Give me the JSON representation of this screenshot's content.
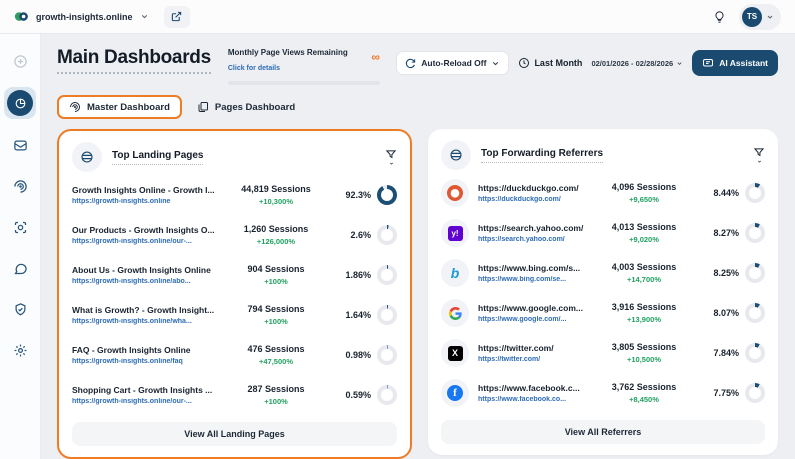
{
  "topbar": {
    "site": "growth-insights.online",
    "avatar_initials": "TS"
  },
  "header": {
    "title": "Main Dashboards",
    "monthly_label": "Monthly Page Views Remaining",
    "monthly_link": "Click for details",
    "infinity": "∞",
    "auto_reload_label": "Auto-Reload Off",
    "period_label": "Last Month",
    "date_range": "02/01/2026 - 02/28/2026",
    "ai_assistant_label": "AI Assistant"
  },
  "tabs": [
    {
      "label": "Master Dashboard",
      "active": true
    },
    {
      "label": "Pages Dashboard",
      "active": false
    }
  ],
  "colors": {
    "accent_orange": "#ee7c25",
    "navy": "#1b4a70",
    "green": "#21a061",
    "link_blue": "#2d6cb4"
  },
  "cards": [
    {
      "title": "Top Landing Pages",
      "footer": "View All Landing Pages",
      "rows": [
        {
          "title": "Growth Insights Online - Growth I...",
          "url": "https://growth-insights.online",
          "sessions": "44,819 Sessions",
          "change": "+10,300%",
          "pct": "92.3%",
          "pct_num": 92.3
        },
        {
          "title": "Our Products - Growth Insights O...",
          "url": "https://growth-insights.online/our-...",
          "sessions": "1,260 Sessions",
          "change": "+126,000%",
          "pct": "2.6%",
          "pct_num": 2.6
        },
        {
          "title": "About Us - Growth Insights Online",
          "url": "https://growth-insights.online/abo...",
          "sessions": "904 Sessions",
          "change": "+100%",
          "pct": "1.86%",
          "pct_num": 1.86
        },
        {
          "title": "What is Growth? - Growth Insight...",
          "url": "https://growth-insights.online/wha...",
          "sessions": "794 Sessions",
          "change": "+100%",
          "pct": "1.64%",
          "pct_num": 1.64
        },
        {
          "title": "FAQ - Growth Insights Online",
          "url": "https://growth-insights.online/faq",
          "sessions": "476 Sessions",
          "change": "+47,500%",
          "pct": "0.98%",
          "pct_num": 0.98
        },
        {
          "title": "Shopping Cart - Growth Insights ...",
          "url": "https://growth-insights.online/our-...",
          "sessions": "287 Sessions",
          "change": "+100%",
          "pct": "0.59%",
          "pct_num": 0.59
        }
      ]
    },
    {
      "title": "Top Forwarding Referrers",
      "footer": "View All Referrers",
      "rows": [
        {
          "title": "https://duckduckgo.com/",
          "url": "https://duckduckgo.com/",
          "brand": "duckduckgo",
          "glyph": "",
          "sessions": "4,096 Sessions",
          "change": "+9,650%",
          "pct": "8.44%",
          "pct_num": 8.44
        },
        {
          "title": "https://search.yahoo.com/",
          "url": "https://search.yahoo.com/",
          "brand": "yahoo",
          "glyph": "y!",
          "sessions": "4,013 Sessions",
          "change": "+9,020%",
          "pct": "8.27%",
          "pct_num": 8.27
        },
        {
          "title": "https://www.bing.com/s...",
          "url": "https://www.bing.com/se...",
          "brand": "bing",
          "glyph": "b",
          "sessions": "4,003 Sessions",
          "change": "+14,700%",
          "pct": "8.25%",
          "pct_num": 8.25
        },
        {
          "title": "https://www.google.com...",
          "url": "https://www.google.com/...",
          "brand": "google",
          "glyph": "G",
          "sessions": "3,916 Sessions",
          "change": "+13,900%",
          "pct": "8.07%",
          "pct_num": 8.07
        },
        {
          "title": "https://twitter.com/",
          "url": "https://twitter.com/",
          "brand": "twitter",
          "glyph": "X",
          "sessions": "3,805 Sessions",
          "change": "+10,500%",
          "pct": "7.84%",
          "pct_num": 7.84
        },
        {
          "title": "https://www.facebook.c...",
          "url": "https://www.facebook.co...",
          "brand": "facebook",
          "glyph": "f",
          "sessions": "3,762 Sessions",
          "change": "+8,450%",
          "pct": "7.75%",
          "pct_num": 7.75
        }
      ]
    }
  ]
}
